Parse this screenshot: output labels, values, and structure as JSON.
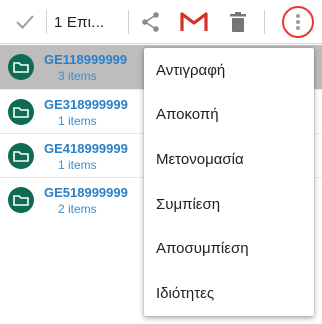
{
  "toolbar": {
    "selection_label": "1 Επι...",
    "icons": {
      "confirm": "check-icon",
      "share": "share-icon",
      "gmail": "gmail-icon",
      "delete": "trash-icon",
      "more": "more-vert-icon"
    },
    "colors": {
      "gmail_red": "#d93025",
      "highlight_ring": "#e53935"
    }
  },
  "files": [
    {
      "name": "GE118999999",
      "count": "3 items",
      "selected": true
    },
    {
      "name": "GE318999999",
      "count": "1 items",
      "selected": false
    },
    {
      "name": "GE418999999",
      "count": "1 items",
      "selected": false
    },
    {
      "name": "GE518999999",
      "count": "2 items",
      "selected": false
    }
  ],
  "menu": {
    "items": [
      "Αντιγραφή",
      "Αποκοπή",
      "Μετονομασία",
      "Συμπίεση",
      "Αποσυμπίεση",
      "Ιδιότητες"
    ]
  },
  "colors": {
    "folder_bg": "#0f6b53",
    "file_name": "#2a80c8",
    "selected_row": "#bdbdbd"
  }
}
